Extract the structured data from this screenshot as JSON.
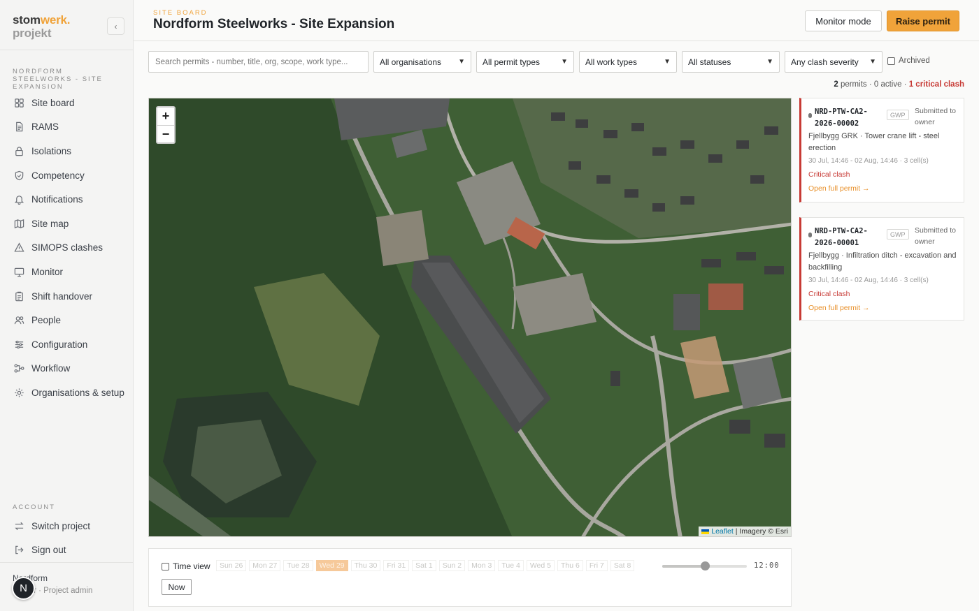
{
  "brand": {
    "part1": "stom",
    "part2": "werk.",
    "part3": "projekt"
  },
  "sidebar": {
    "project_label": "NORDFORM STEELWORKS - SITE EXPANSION",
    "items": [
      {
        "label": "Site board",
        "icon": "grid-icon"
      },
      {
        "label": "RAMS",
        "icon": "document-icon"
      },
      {
        "label": "Isolations",
        "icon": "lock-icon"
      },
      {
        "label": "Competency",
        "icon": "shield-check-icon"
      },
      {
        "label": "Notifications",
        "icon": "bell-icon"
      },
      {
        "label": "Site map",
        "icon": "map-icon"
      },
      {
        "label": "SIMOPS clashes",
        "icon": "warning-icon"
      },
      {
        "label": "Monitor",
        "icon": "monitor-icon"
      },
      {
        "label": "Shift handover",
        "icon": "clipboard-icon"
      },
      {
        "label": "People",
        "icon": "people-icon"
      },
      {
        "label": "Configuration",
        "icon": "sliders-icon"
      },
      {
        "label": "Workflow",
        "icon": "workflow-icon"
      },
      {
        "label": "Organisations & setup",
        "icon": "gear-icon"
      }
    ],
    "account_label": "ACCOUNT",
    "account_items": [
      {
        "label": "Switch project",
        "icon": "switch-icon"
      },
      {
        "label": "Sign out",
        "icon": "sign-out-icon"
      }
    ],
    "user": {
      "name": "Nordform",
      "role": "Owner · Project admin",
      "avatar_letter": "N"
    }
  },
  "header": {
    "eyebrow": "SITE BOARD",
    "title": "Nordform Steelworks - Site Expansion",
    "monitor_label": "Monitor mode",
    "raise_label": "Raise permit"
  },
  "filters": {
    "search_placeholder": "Search permits - number, title, org, scope, work type...",
    "organisations": "All organisations",
    "permit_types": "All permit types",
    "work_types": "All work types",
    "statuses": "All statuses",
    "clash_severity": "Any clash severity",
    "archived_label": "Archived"
  },
  "summary": {
    "count": "2",
    "permits_text": "permits · 0 active ·",
    "critical_text": "1 critical clash"
  },
  "map": {
    "zoom_in": "+",
    "zoom_out": "−",
    "attribution_leaflet": "Leaflet",
    "attribution_rest": "| Imagery © Esri"
  },
  "permits": [
    {
      "code": "NRD-PTW-CA2-2026-00002",
      "tag": "GWP",
      "status": "Submitted to owner",
      "description": "Fjellbygg GRK · Tower crane lift - steel erection",
      "time": "30 Jul, 14:46 - 02 Aug, 14:46 · 3 cell(s)",
      "clash": "Critical clash",
      "open_label": "Open full permit →"
    },
    {
      "code": "NRD-PTW-CA2-2026-00001",
      "tag": "GWP",
      "status": "Submitted to owner",
      "description": "Fjellbygg · Infiltration ditch - excavation and backfilling",
      "time": "30 Jul, 14:46 - 02 Aug, 14:46 · 3 cell(s)",
      "clash": "Critical clash",
      "open_label": "Open full permit →"
    }
  ],
  "timeline": {
    "time_view_label": "Time view",
    "days": [
      "Sun 26",
      "Mon 27",
      "Tue 28",
      "Wed 29",
      "Thu 30",
      "Fri 31",
      "Sat 1",
      "Sun 2",
      "Mon 3",
      "Tue 4",
      "Wed 5",
      "Thu 6",
      "Fri 7",
      "Sat 8"
    ],
    "active_day": "Wed 29",
    "slider_fraction": 0.5,
    "clock": "12:00",
    "now_label": "Now"
  },
  "colors": {
    "accent": "#f0a33a",
    "critical": "#c73a35"
  }
}
